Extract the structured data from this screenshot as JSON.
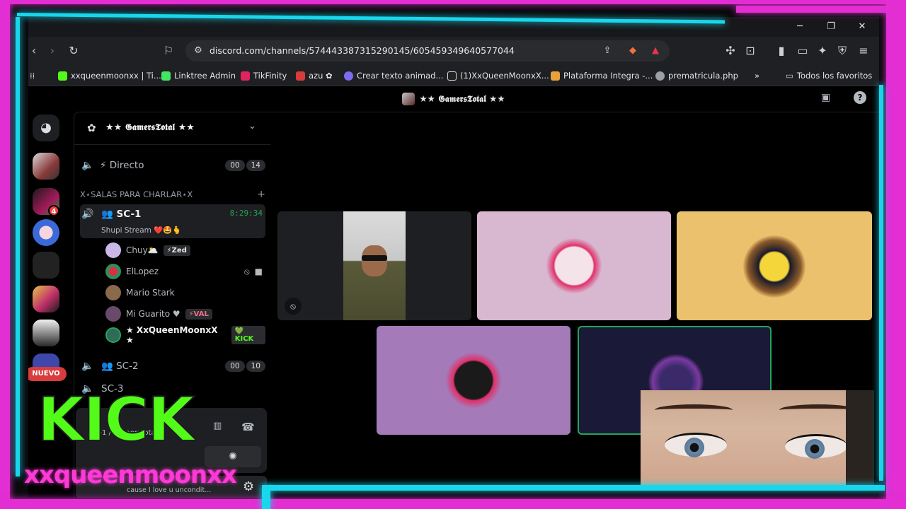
{
  "browser": {
    "url": "discord.com/channels/574443387315290145/605459349640577044",
    "bookmarks": [
      {
        "label": "xxqueenmoonxx | Ti...",
        "color": "#53fc18"
      },
      {
        "label": "Linktree Admin",
        "color": "#43e660"
      },
      {
        "label": "TikFinity",
        "color": "#e0245e"
      },
      {
        "label": "azu ✿",
        "color": "#d93b3b"
      },
      {
        "label": "Crear texto animad...",
        "color": "#7b6cf0"
      },
      {
        "label": "(1)XxQueenMoonxX...",
        "color": "#222222"
      },
      {
        "label": "Plataforma Integra -...",
        "color": "#e9a23b"
      },
      {
        "label": "prematricula.php",
        "color": "#9aa0a6"
      }
    ],
    "more_bookmarks": "»",
    "all_bookmarks": "Todos los favoritos"
  },
  "discord": {
    "window_title": "★★ 𝕲𝖆𝖒𝖊𝖗𝖘𝕿𝖔𝖙𝖆𝖑 ★★",
    "server_name": "★★ 𝕲𝖆𝖒𝖊𝖗𝖘𝕿𝖔𝖙𝖆𝖑 ★★",
    "directo": {
      "label": "Directo",
      "count_a": "00",
      "count_b": "14"
    },
    "category": "X⋆SALAS PARA CHARLAR⋆X",
    "sc1": {
      "label": "SC-1",
      "timer": "8:29:34",
      "status": "Shupi Stream ❤️🤩🫰"
    },
    "users": [
      {
        "name": "Chuy🌥️",
        "tag": "⚡Zed",
        "color": "#c9b8e8"
      },
      {
        "name": "ElLopez",
        "tag": "",
        "color": "#2f8f5a"
      },
      {
        "name": "Mario Stark",
        "tag": "",
        "color": "#8a6a4a"
      },
      {
        "name": "Mi Guarito ♥",
        "tag": "⚡VAL",
        "color": "#6a4a6a"
      },
      {
        "name": "★ XxQueenMoonxX ★",
        "tag": "💚KICK",
        "color": "#2f6a5a"
      }
    ],
    "sc2": {
      "label": "SC-2",
      "count_a": "00",
      "count_b": "10"
    },
    "sc3": {
      "label": "SC-3"
    },
    "voice_panel": {
      "line1": "SC-1 / GamersTotal"
    },
    "user_panel": {
      "status": "cause I love u uncondit..."
    },
    "nuevo_badge": "NUEVO",
    "guild_badge": "4"
  },
  "overlay": {
    "kick_logo_text": "KICK",
    "handle": "xxqueenmoonxx"
  },
  "colors": {
    "neon_cyan": "#19d6ec",
    "neon_pink": "#e22ed2",
    "discord_green": "#23a55a",
    "kick_green": "#53fc18"
  }
}
